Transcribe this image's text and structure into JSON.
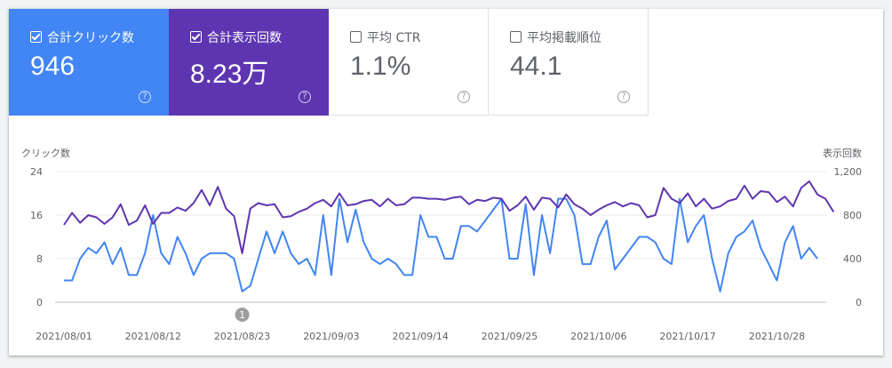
{
  "metrics": [
    {
      "label": "合計クリック数",
      "value": "946",
      "checked": true,
      "color": "#4285f4"
    },
    {
      "label": "合計表示回数",
      "value": "8.23万",
      "checked": true,
      "color": "#5e35b1"
    },
    {
      "label": "平均 CTR",
      "value": "1.1%",
      "checked": false
    },
    {
      "label": "平均掲載順位",
      "value": "44.1",
      "checked": false
    }
  ],
  "help_icon": "?",
  "chart_data": {
    "type": "line",
    "y_left_label": "クリック数",
    "y_right_label": "表示回数",
    "y_left_ticks": [
      "24",
      "16",
      "8",
      "0"
    ],
    "y_right_ticks": [
      "1,200",
      "800",
      "400",
      "0"
    ],
    "y_left_range": [
      0,
      24
    ],
    "y_right_range": [
      0,
      1200
    ],
    "x_tick_labels": [
      "2021/08/01",
      "2021/08/12",
      "2021/08/23",
      "2021/09/03",
      "2021/09/14",
      "2021/09/25",
      "2021/10/06",
      "2021/10/17",
      "2021/10/28"
    ],
    "grid": true,
    "annotation": {
      "label": "1",
      "index": 22
    },
    "series": [
      {
        "name": "合計クリック数",
        "axis": "left",
        "color": "#4285f4",
        "values": [
          4,
          4,
          8,
          10,
          9,
          11,
          7,
          10,
          5,
          5,
          9,
          16,
          9,
          7,
          12,
          9,
          5,
          8,
          9,
          9,
          9,
          8,
          2,
          3,
          8,
          13,
          9,
          13,
          9,
          7,
          8,
          5,
          16,
          5,
          19,
          11,
          17,
          11,
          8,
          7,
          8,
          7,
          5,
          5,
          16,
          12,
          12,
          8,
          8,
          14,
          14,
          13,
          15,
          17,
          19,
          8,
          8,
          18,
          5,
          16,
          9,
          19,
          19,
          16,
          7,
          7,
          12,
          15,
          6,
          8,
          10,
          12,
          12,
          11,
          8,
          7,
          19,
          11,
          14,
          16,
          8,
          2,
          9,
          12,
          13,
          15,
          10,
          7,
          4,
          11,
          14,
          8,
          10,
          8
        ]
      },
      {
        "name": "合計表示回数",
        "axis": "right",
        "color": "#5e35b1",
        "values": [
          710,
          820,
          730,
          800,
          780,
          720,
          780,
          900,
          710,
          750,
          890,
          720,
          820,
          820,
          870,
          840,
          910,
          1030,
          890,
          1060,
          860,
          790,
          450,
          860,
          910,
          890,
          900,
          780,
          790,
          830,
          860,
          910,
          940,
          880,
          1000,
          890,
          900,
          930,
          940,
          880,
          950,
          890,
          900,
          960,
          960,
          950,
          950,
          940,
          960,
          970,
          900,
          940,
          930,
          960,
          950,
          840,
          890,
          970,
          850,
          960,
          950,
          870,
          990,
          900,
          860,
          800,
          850,
          890,
          920,
          880,
          910,
          890,
          780,
          800,
          1050,
          950,
          910,
          1000,
          880,
          950,
          860,
          880,
          930,
          950,
          1070,
          950,
          1020,
          1010,
          920,
          970,
          880,
          1050,
          1110,
          990,
          950,
          830
        ]
      }
    ]
  }
}
